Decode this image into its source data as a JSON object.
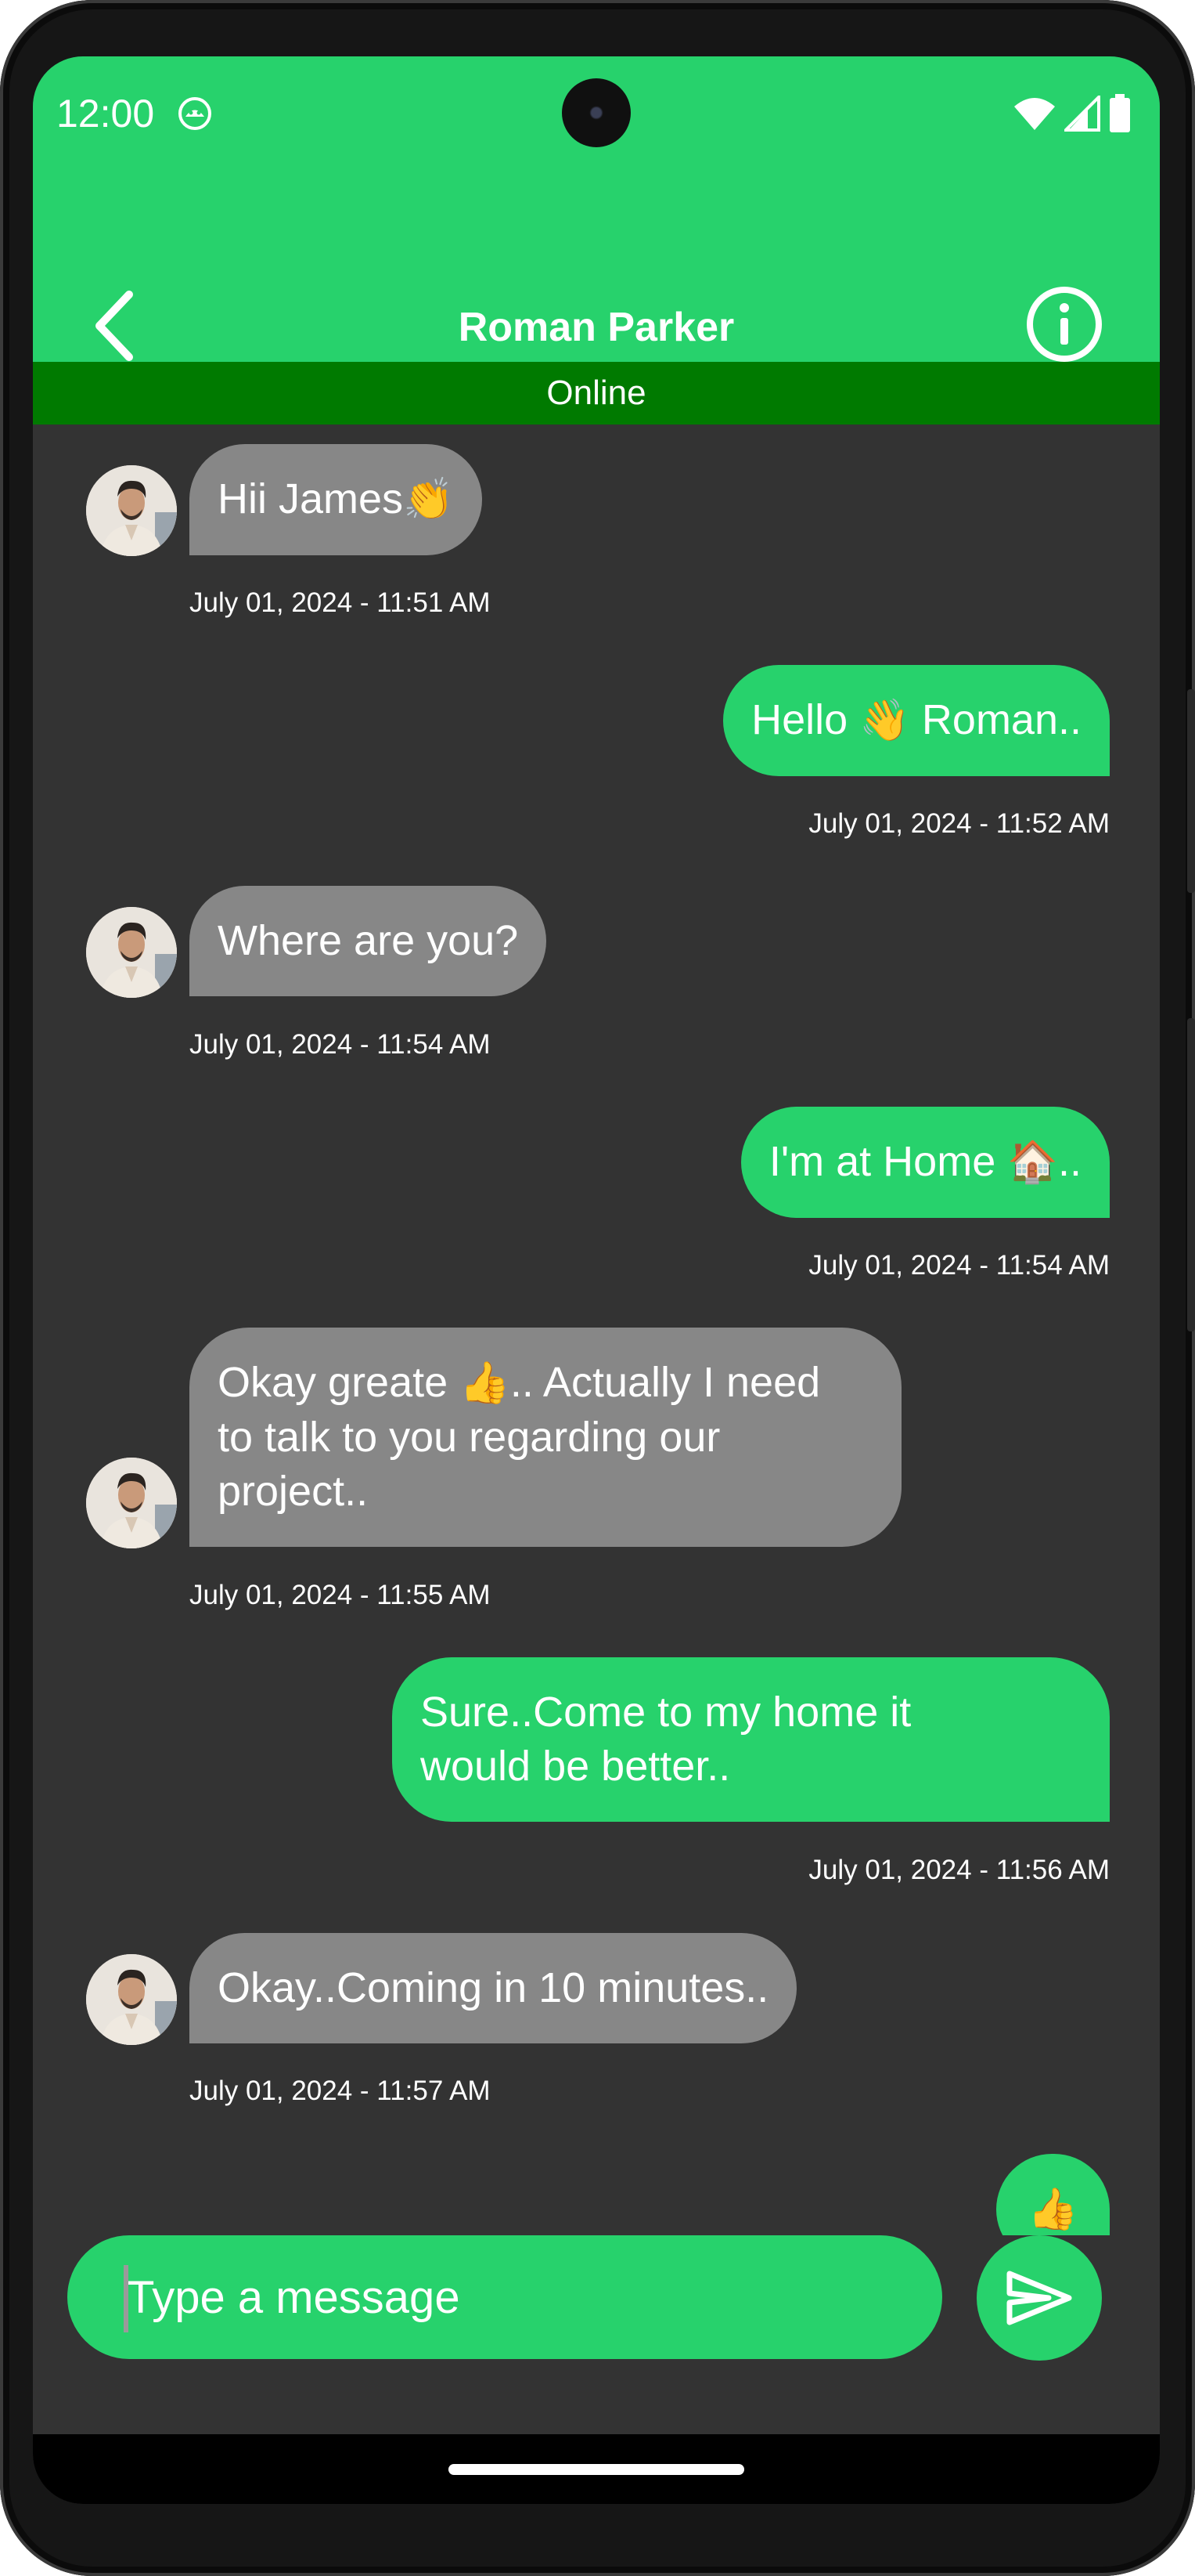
{
  "status_bar": {
    "time": "12:00",
    "icons": [
      "android-debug-icon",
      "wifi-icon",
      "signal-icon",
      "battery-icon"
    ]
  },
  "header": {
    "title": "Roman Parker",
    "back_icon": "chevron-left-icon",
    "info_icon": "info-icon"
  },
  "presence": {
    "status": "Online"
  },
  "messages": [
    {
      "direction": "in",
      "text": "Hii James",
      "emoji": "👏",
      "time": "July 01, 2024 - 11:51 AM"
    },
    {
      "direction": "out",
      "text_before": "Hello ",
      "emoji": "👋",
      "text_after": " Roman..",
      "time": "July 01, 2024 - 11:52 AM"
    },
    {
      "direction": "in",
      "text": "Where are you?",
      "time": "July 01, 2024 - 11:54 AM"
    },
    {
      "direction": "out",
      "text_before": "I'm at Home ",
      "emoji": "🏠",
      "text_after": "..",
      "time": "July 01, 2024 - 11:54 AM"
    },
    {
      "direction": "in",
      "line1_before": "Okay greate ",
      "emoji": "👍",
      "line1_after": ".. Actually I need",
      "line2": "to talk to you regarding our",
      "line3": "project..",
      "time": "July 01, 2024 - 11:55 AM"
    },
    {
      "direction": "out",
      "line1": "Sure..Come to my home it",
      "line2": "would be better..",
      "time": "July 01, 2024 - 11:56 AM"
    },
    {
      "direction": "in",
      "text": "Okay..Coming in 10 minutes..",
      "time": "July 01, 2024 - 11:57 AM"
    },
    {
      "direction": "out",
      "emoji": "👍"
    }
  ],
  "composer": {
    "placeholder": "Type a message",
    "send_icon": "send-icon"
  },
  "colors": {
    "brand_green": "#27d26c",
    "online_banner": "#007a00",
    "chat_background": "#333333",
    "incoming_bubble": "#878787"
  }
}
